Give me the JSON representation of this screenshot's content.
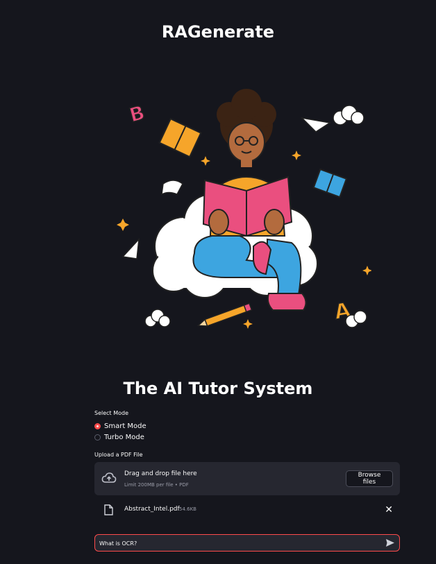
{
  "app": {
    "title": "RAGenerate",
    "subtitle": "The AI Tutor System"
  },
  "mode": {
    "label": "Select Mode",
    "options": [
      {
        "label": "Smart Mode",
        "selected": true
      },
      {
        "label": "Turbo Mode",
        "selected": false
      }
    ]
  },
  "upload": {
    "label": "Upload a PDF File",
    "drop_title": "Drag and drop file here",
    "limit_text": "Limit 200MB per file • PDF",
    "browse_label": "Browse files",
    "icon": "cloud-upload-icon",
    "file": {
      "name": "Abstract_Intel.pdf",
      "size": "54.6KB",
      "icon": "file-icon"
    }
  },
  "chat": {
    "value": "What is OCR?",
    "send_icon": "send-icon"
  },
  "colors": {
    "accent": "#ff4b4b",
    "background": "#15161d",
    "panel": "#262730"
  },
  "hero_image": "illustration of a child reading a pink book on a cloud with flying books, paper planes, pencil and letters A and B"
}
